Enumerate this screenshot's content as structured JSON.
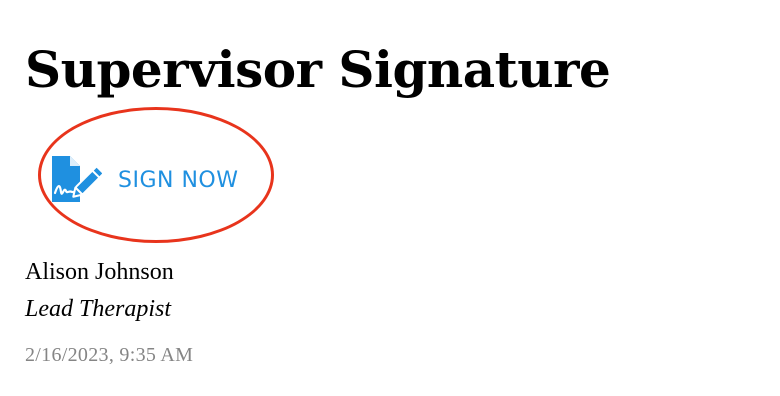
{
  "section": {
    "title": "Supervisor Signature"
  },
  "sign_button": {
    "label": "SIGN NOW",
    "icon": "document-sign-icon",
    "color": "#1f90e0"
  },
  "highlight": {
    "color": "#e8341c"
  },
  "signer": {
    "name": "Alison Johnson",
    "role": "Lead Therapist",
    "timestamp": "2/16/2023, 9:35 AM"
  }
}
